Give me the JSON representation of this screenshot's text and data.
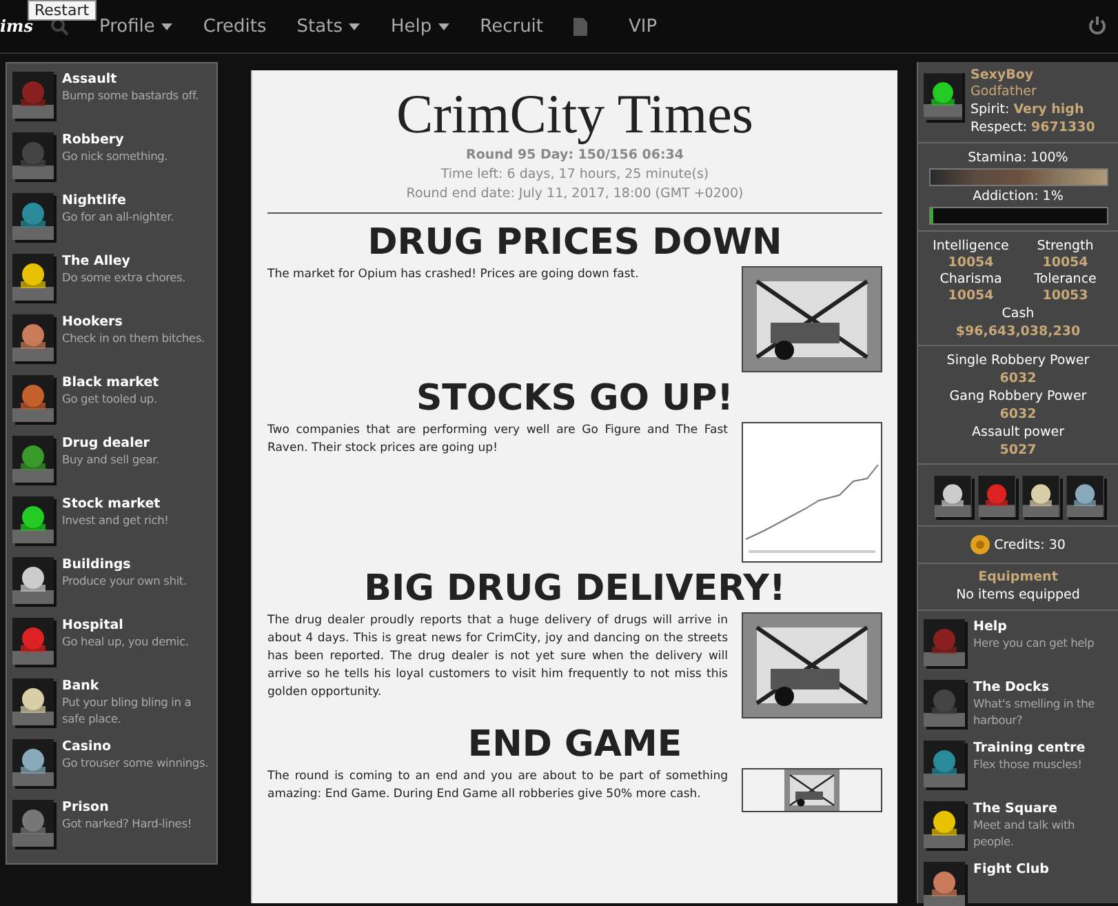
{
  "tooltip": "Restart",
  "logo": "ims",
  "nav": [
    {
      "label": "Profile",
      "dropdown": true
    },
    {
      "label": "Credits",
      "dropdown": false
    },
    {
      "label": "Stats",
      "dropdown": true
    },
    {
      "label": "Help",
      "dropdown": true
    },
    {
      "label": "Recruit",
      "dropdown": false
    },
    {
      "kind": "icon"
    },
    {
      "label": "VIP",
      "dropdown": false
    }
  ],
  "left_menu": [
    {
      "title": "Assault",
      "desc": "Bump some bastards off."
    },
    {
      "title": "Robbery",
      "desc": "Go nick something."
    },
    {
      "title": "Nightlife",
      "desc": "Go for an all-nighter."
    },
    {
      "title": "The Alley",
      "desc": "Do some extra chores."
    },
    {
      "title": "Hookers",
      "desc": "Check in on them bitches."
    },
    {
      "title": "Black market",
      "desc": "Go get tooled up."
    },
    {
      "title": "Drug dealer",
      "desc": "Buy and sell gear."
    },
    {
      "title": "Stock market",
      "desc": "Invest and get rich!"
    },
    {
      "title": "Buildings",
      "desc": "Produce your own shit."
    },
    {
      "title": "Hospital",
      "desc": "Go heal up, you demic."
    },
    {
      "title": "Bank",
      "desc": "Put your bling bling in a safe place."
    },
    {
      "title": "Casino",
      "desc": "Go trouser some winnings."
    },
    {
      "title": "Prison",
      "desc": "Got narked? Hard-lines!"
    }
  ],
  "newspaper": {
    "title": "CrimCity Times",
    "round": "Round 95 Day: 150/156 06:34",
    "time_left": "Time left: 6 days, 17 hours, 25 minute(s)",
    "end_date": "Round end date: July 11, 2017, 18:00 (GMT +0200)",
    "articles": [
      {
        "headline": "DRUG PRICES DOWN",
        "body": "The market for Opium has crashed! Prices are going down fast.",
        "kind": "picture"
      },
      {
        "headline": "STOCKS GO UP!",
        "body": "Two companies that are performing very well are Go Figure and The Fast Raven. Their stock prices are going up!",
        "kind": "chart"
      },
      {
        "headline": "BIG DRUG DELIVERY!",
        "body": "The drug dealer proudly reports that a huge delivery of drugs will arrive in about 4 days. This is great news for CrimCity, joy and dancing on the streets has been reported. The drug dealer is not yet sure when the delivery will arrive so he tells his loyal customers to visit him frequently to not miss this golden opportunity.",
        "kind": "picture"
      },
      {
        "headline": "END GAME",
        "body": "The round is coming to an end and you are about to be part of something amazing: End Game. During End Game all robberies give 50% more cash.",
        "kind": "picture"
      }
    ]
  },
  "profile": {
    "name": "SexyBoy",
    "rank": "Godfather",
    "spirit_label": "Spirit:",
    "spirit": "Very high",
    "respect_label": "Respect:",
    "respect": "9671330"
  },
  "stamina": {
    "label": "Stamina: 100%",
    "level": 1.0
  },
  "addiction": {
    "label": "Addiction: 1%",
    "level": 0.01
  },
  "stats": [
    {
      "label": "Intelligence",
      "value": "10054"
    },
    {
      "label": "Strength",
      "value": "10054"
    },
    {
      "label": "Charisma",
      "value": "10054"
    },
    {
      "label": "Tolerance",
      "value": "10053"
    }
  ],
  "cash": {
    "label": "Cash",
    "value": "$96,643,038,230"
  },
  "powers": [
    {
      "label": "Single Robbery Power",
      "value": "6032"
    },
    {
      "label": "Gang Robbery Power",
      "value": "6032"
    },
    {
      "label": "Assault power",
      "value": "5027"
    }
  ],
  "credits": "Credits: 30",
  "equipment": {
    "title": "Equipment",
    "text": "No items equipped"
  },
  "right_menu": [
    {
      "title": "Help",
      "desc": "Here you can get help"
    },
    {
      "title": "The Docks",
      "desc": "What's smelling in the harbour?"
    },
    {
      "title": "Training centre",
      "desc": "Flex those muscles!"
    },
    {
      "title": "The Square",
      "desc": "Meet and talk with people."
    },
    {
      "title": "Fight Club"
    }
  ]
}
